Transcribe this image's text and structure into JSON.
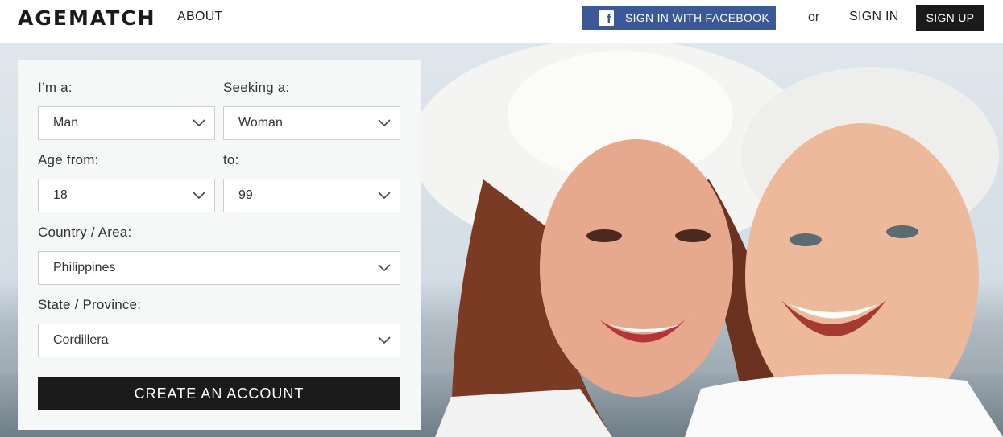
{
  "header": {
    "logo": "AGEMATCH",
    "nav_about": "ABOUT",
    "facebook_button": "SIGN IN WITH FACEBOOK",
    "or_text": "or",
    "sign_in": "SIGN IN",
    "sign_up": "SIGN UP"
  },
  "form": {
    "im_a_label": "I’m a:",
    "im_a_value": "Man",
    "seeking_label": "Seeking a:",
    "seeking_value": "Woman",
    "age_from_label": "Age from:",
    "age_from_value": "18",
    "age_to_label": "to:",
    "age_to_value": "99",
    "country_label": "Country / Area:",
    "country_value": "Philippines",
    "state_label": "State / Province:",
    "state_value": "Cordillera",
    "submit": "CREATE AN ACCOUNT"
  },
  "colors": {
    "facebook": "#3b5998",
    "dark": "#1b1b1b",
    "panel": "#f6f8f7"
  },
  "icons": {
    "facebook": "facebook-icon",
    "dropdown": "chevron-down-icon"
  }
}
